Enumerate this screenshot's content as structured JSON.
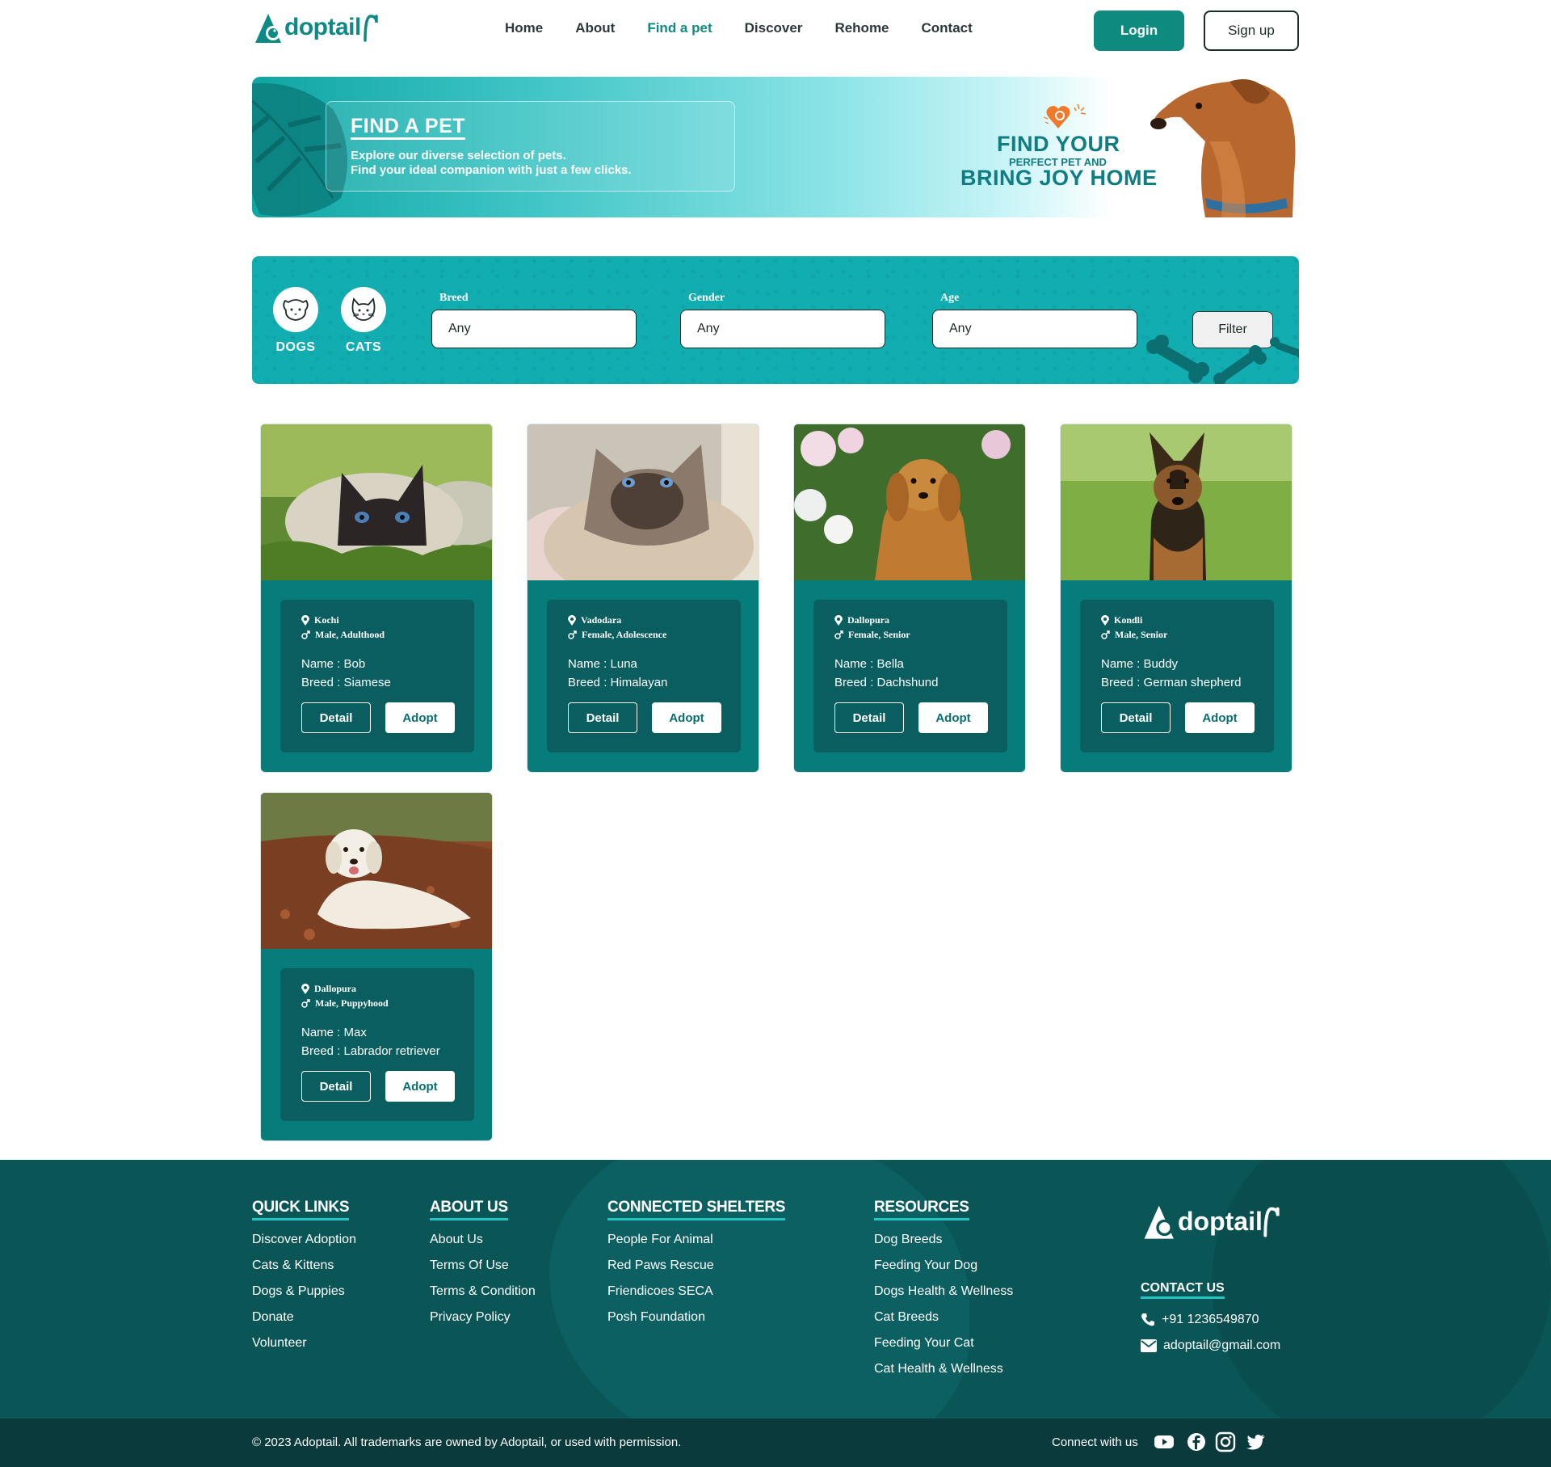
{
  "brand": {
    "name": "doptail",
    "accent": "#0e8a84"
  },
  "nav": {
    "items": [
      {
        "label": "Home",
        "active": false
      },
      {
        "label": "About",
        "active": false
      },
      {
        "label": "Find a pet",
        "active": true
      },
      {
        "label": "Discover",
        "active": false
      },
      {
        "label": "Rehome",
        "active": false
      },
      {
        "label": "Contact",
        "active": false
      }
    ],
    "login": "Login",
    "signup": "Sign up"
  },
  "banner": {
    "title": "FIND A PET",
    "line1": "Explore our diverse selection of pets.",
    "line2": "Find your ideal companion with just a few clicks.",
    "tagline_top": "FIND YOUR",
    "tagline_mid": "PERFECT PET AND",
    "tagline_bottom": "BRING JOY HOME"
  },
  "filter": {
    "pet_types": [
      {
        "label": "DOGS",
        "icon": "dog-face-icon"
      },
      {
        "label": "CATS",
        "icon": "cat-face-icon"
      }
    ],
    "breed": {
      "label": "Breed",
      "value": "Any"
    },
    "gender": {
      "label": "Gender",
      "value": "Any"
    },
    "age": {
      "label": "Age",
      "value": "Any"
    },
    "button": "Filter"
  },
  "pets": [
    {
      "location": "Kochi",
      "gender_age": "Male, Adulthood",
      "name": "Name : Bob",
      "breed": "Breed : Siamese",
      "detail": "Detail",
      "adopt": "Adopt"
    },
    {
      "location": "Vadodara",
      "gender_age": "Female, Adolescence",
      "name": "Name : Luna",
      "breed": "Breed : Himalayan",
      "detail": "Detail",
      "adopt": "Adopt"
    },
    {
      "location": "Dallopura",
      "gender_age": "Female, Senior",
      "name": "Name : Bella",
      "breed": "Breed : Dachshund",
      "detail": "Detail",
      "adopt": "Adopt"
    },
    {
      "location": "Kondli",
      "gender_age": "Male, Senior",
      "name": "Name : Buddy",
      "breed": "Breed : German shepherd",
      "detail": "Detail",
      "adopt": "Adopt"
    },
    {
      "location": "Dallopura",
      "gender_age": "Male, Puppyhood",
      "name": "Name : Max",
      "breed": "Breed : Labrador retriever",
      "detail": "Detail",
      "adopt": "Adopt"
    }
  ],
  "footer": {
    "quick_links": {
      "title": "QUICK LINKS",
      "items": [
        "Discover Adoption",
        "Cats & Kittens",
        "Dogs & Puppies",
        "Donate",
        "Volunteer"
      ]
    },
    "about_us": {
      "title": "ABOUT US",
      "items": [
        "About Us",
        "Terms Of Use",
        "Terms & Condition",
        "Privacy Policy"
      ]
    },
    "shelters": {
      "title": "CONNECTED SHELTERS",
      "items": [
        "People For Animal",
        "Red Paws Rescue",
        "Friendicoes SECA",
        "Posh Foundation"
      ]
    },
    "resources": {
      "title": "RESOURCES",
      "items": [
        "Dog Breeds",
        "Feeding Your Dog",
        "Dogs Health & Wellness",
        "Cat Breeds",
        "Feeding Your Cat",
        "Cat Health & Wellness"
      ]
    },
    "contact": {
      "title": "CONTACT US",
      "phone": "+91 1236549870",
      "email": "adoptail@gmail.com"
    },
    "copyright": "© 2023 Adoptail. All trademarks are owned by Adoptail, or used with permission.",
    "connect": "Connect with us",
    "social": [
      "youtube-icon",
      "facebook-icon",
      "instagram-icon",
      "twitter-icon"
    ]
  }
}
